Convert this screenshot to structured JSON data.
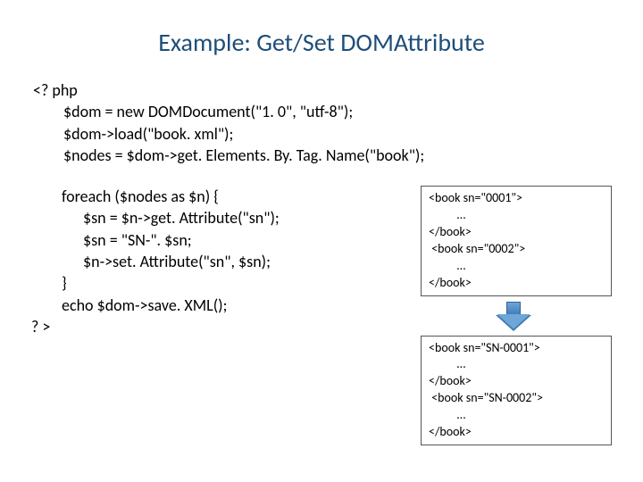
{
  "title": "Example: Get/Set DOMAttribute",
  "code_top": {
    "l1": "<? php",
    "l2": "$dom = new DOMDocument(\"1. 0\", \"utf-8\");",
    "l3": "$dom->load(\"book. xml\");",
    "l4": "$nodes = $dom->get. Elements. By. Tag. Name(\"book\");"
  },
  "code_left": {
    "l1": "foreach ($nodes as $n) {",
    "l2": "$sn = $n->get. Attribute(\"sn\");",
    "l3": "$sn = \"SN-\". $sn;",
    "l4": "$n->set. Attribute(\"sn\", $sn);",
    "l5": "}",
    "l6": "echo $dom->save. XML();",
    "l7": "? >"
  },
  "box_top": {
    "l1": "<book sn=\"0001\">",
    "l2": "          …",
    "l3": "</book>",
    "l4": " <book sn=\"0002\">",
    "l5": "          …",
    "l6": "</book>"
  },
  "box_bottom": {
    "l1": "<book sn=\"SN-0001\">",
    "l2": "          …",
    "l3": "</book>",
    "l4": " <book sn=\"SN-0002\">",
    "l5": "          …",
    "l6": "</book>"
  }
}
